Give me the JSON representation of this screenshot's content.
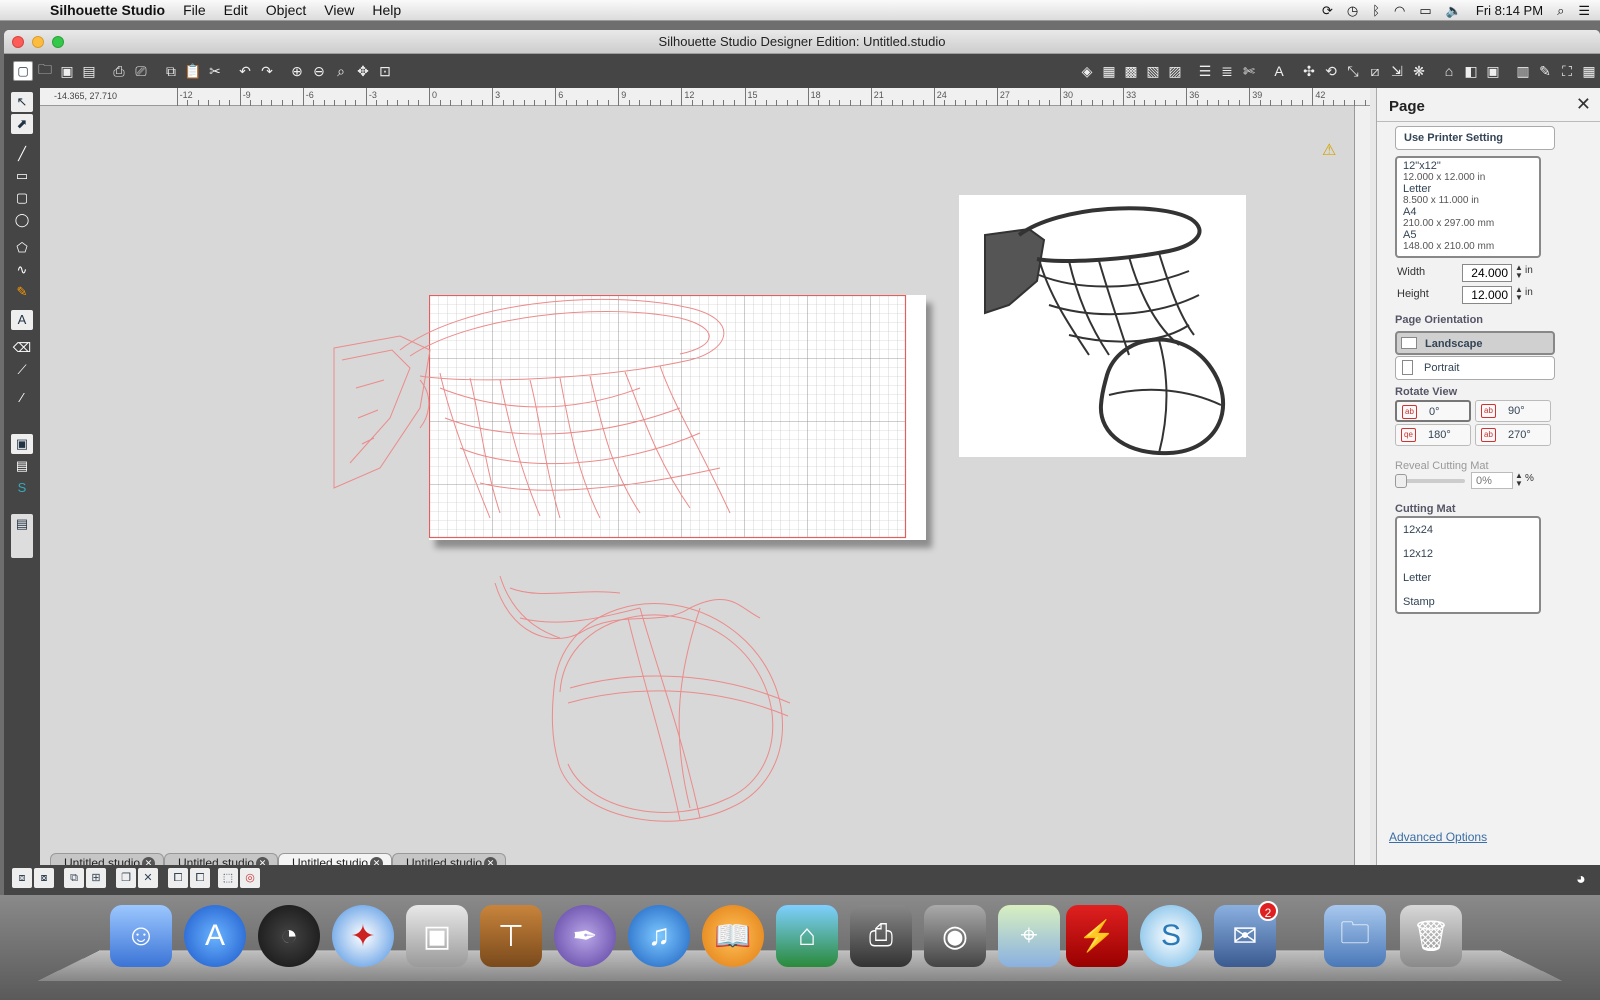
{
  "menubar": {
    "app_name": "Silhouette Studio",
    "items": [
      "File",
      "Edit",
      "Object",
      "View",
      "Help"
    ],
    "clock": "Fri 8:14 PM"
  },
  "window": {
    "title": "Silhouette Studio Designer Edition: Untitled.studio"
  },
  "canvas": {
    "coords": "-14.365, 27.710",
    "ruler_labels": [
      "-12",
      "-9",
      "-6",
      "-3",
      "0",
      "3",
      "6",
      "9",
      "12",
      "15",
      "18",
      "21",
      "24",
      "27",
      "30",
      "33",
      "36",
      "39",
      "42"
    ]
  },
  "tabs": [
    {
      "label": "Untitled.studio",
      "active": false
    },
    {
      "label": "Untitled.studio",
      "active": false
    },
    {
      "label": "Untitled.studio",
      "active": true
    },
    {
      "label": "Untitled.studio",
      "active": false
    }
  ],
  "panel": {
    "title": "Page",
    "printer_button": "Use Printer Setting",
    "page_sizes": [
      {
        "name": "12\"x12\"",
        "size": "12.000 x 12.000 in"
      },
      {
        "name": "Letter",
        "size": "8.500 x 11.000 in"
      },
      {
        "name": "A4",
        "size": "210.00 x 297.00 mm"
      },
      {
        "name": "A5",
        "size": "148.00 x 210.00 mm"
      }
    ],
    "width_label": "Width",
    "width_value": "24.000",
    "height_label": "Height",
    "height_value": "12.000",
    "unit": "in",
    "orientation_label": "Page Orientation",
    "orientation_options": [
      "Landscape",
      "Portrait"
    ],
    "orientation_selected": "Landscape",
    "rotate_label": "Rotate View",
    "rotate_options": [
      "0°",
      "90°",
      "180°",
      "270°"
    ],
    "rotate_selected": "0°",
    "reveal_label": "Reveal Cutting Mat",
    "reveal_value": "0%",
    "percent": "%",
    "cutting_mat_label": "Cutting Mat",
    "cutting_mats": [
      "12x24",
      "12x12",
      "Letter",
      "Stamp"
    ],
    "advanced_link": "Advanced Options"
  },
  "dock": {
    "mail_badge": "2"
  },
  "colors": {
    "cut_line": "#e88080",
    "toolbar_bg": "#454545",
    "canvas_bg": "#d8d8d8"
  }
}
